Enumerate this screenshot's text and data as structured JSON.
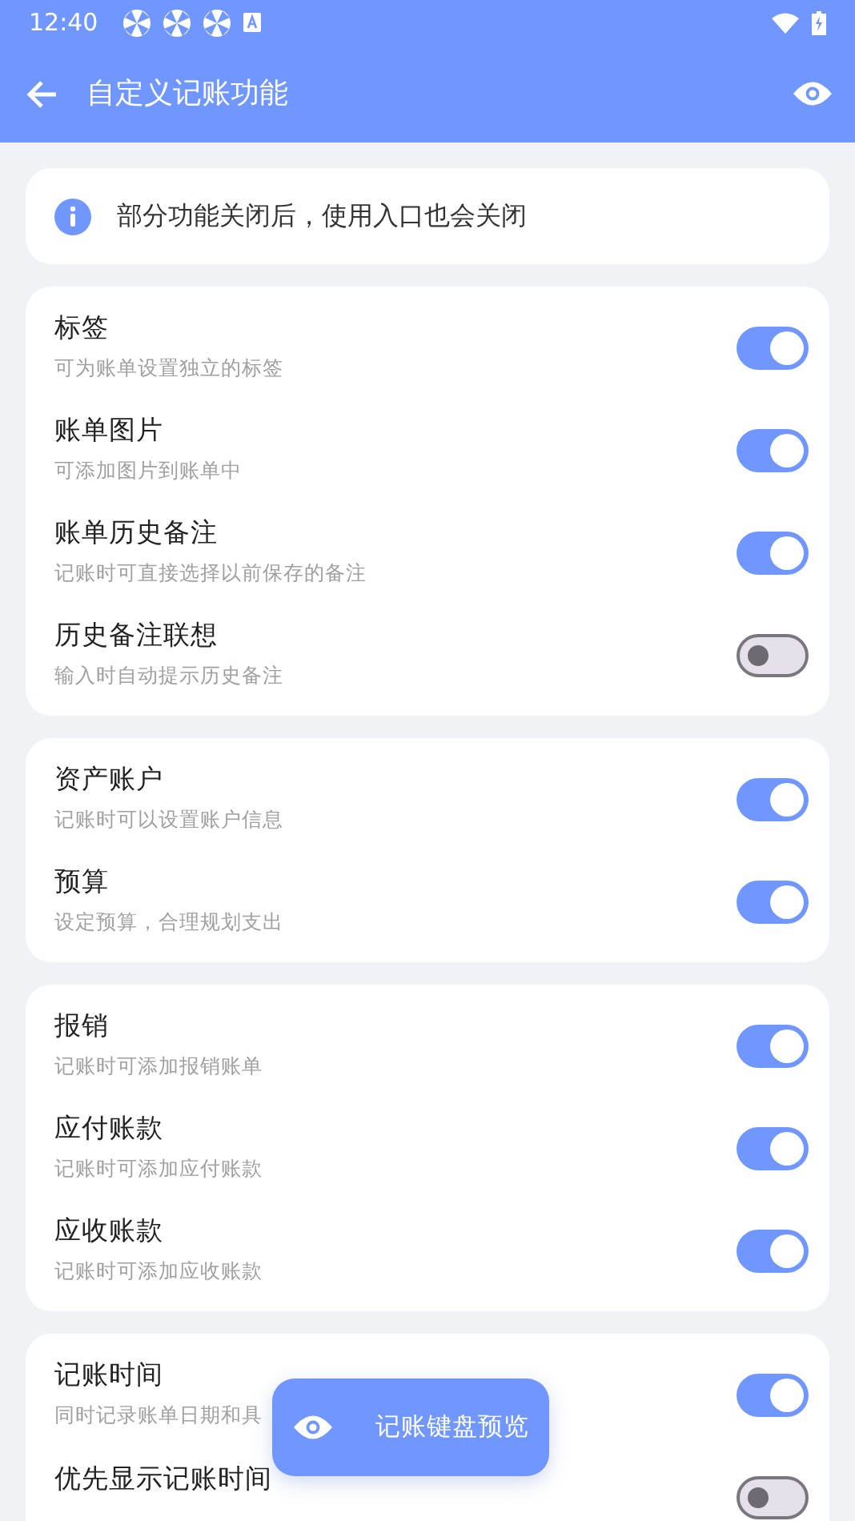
{
  "status_bar": {
    "time": "12:40"
  },
  "app_bar": {
    "title": "自定义记账功能"
  },
  "notice": {
    "text": "部分功能关闭后，使用入口也会关闭"
  },
  "groups": [
    {
      "items": [
        {
          "title": "标签",
          "subtitle": "可为账单设置独立的标签",
          "on": true
        },
        {
          "title": "账单图片",
          "subtitle": "可添加图片到账单中",
          "on": true
        },
        {
          "title": "账单历史备注",
          "subtitle": "记账时可直接选择以前保存的备注",
          "on": true
        },
        {
          "title": "历史备注联想",
          "subtitle": "输入时自动提示历史备注",
          "on": false
        }
      ]
    },
    {
      "items": [
        {
          "title": "资产账户",
          "subtitle": "记账时可以设置账户信息",
          "on": true
        },
        {
          "title": "预算",
          "subtitle": "设定预算，合理规划支出",
          "on": true
        }
      ]
    },
    {
      "items": [
        {
          "title": "报销",
          "subtitle": "记账时可添加报销账单",
          "on": true
        },
        {
          "title": "应付账款",
          "subtitle": "记账时可添加应付账款",
          "on": true
        },
        {
          "title": "应收账款",
          "subtitle": "记账时可添加应收账款",
          "on": true
        }
      ]
    },
    {
      "items": [
        {
          "title": "记账时间",
          "subtitle": "同时记录账单日期和具",
          "on": true
        },
        {
          "title": "优先显示记账时间",
          "on": false
        }
      ]
    }
  ],
  "fab": {
    "label": "记账键盘预览"
  }
}
